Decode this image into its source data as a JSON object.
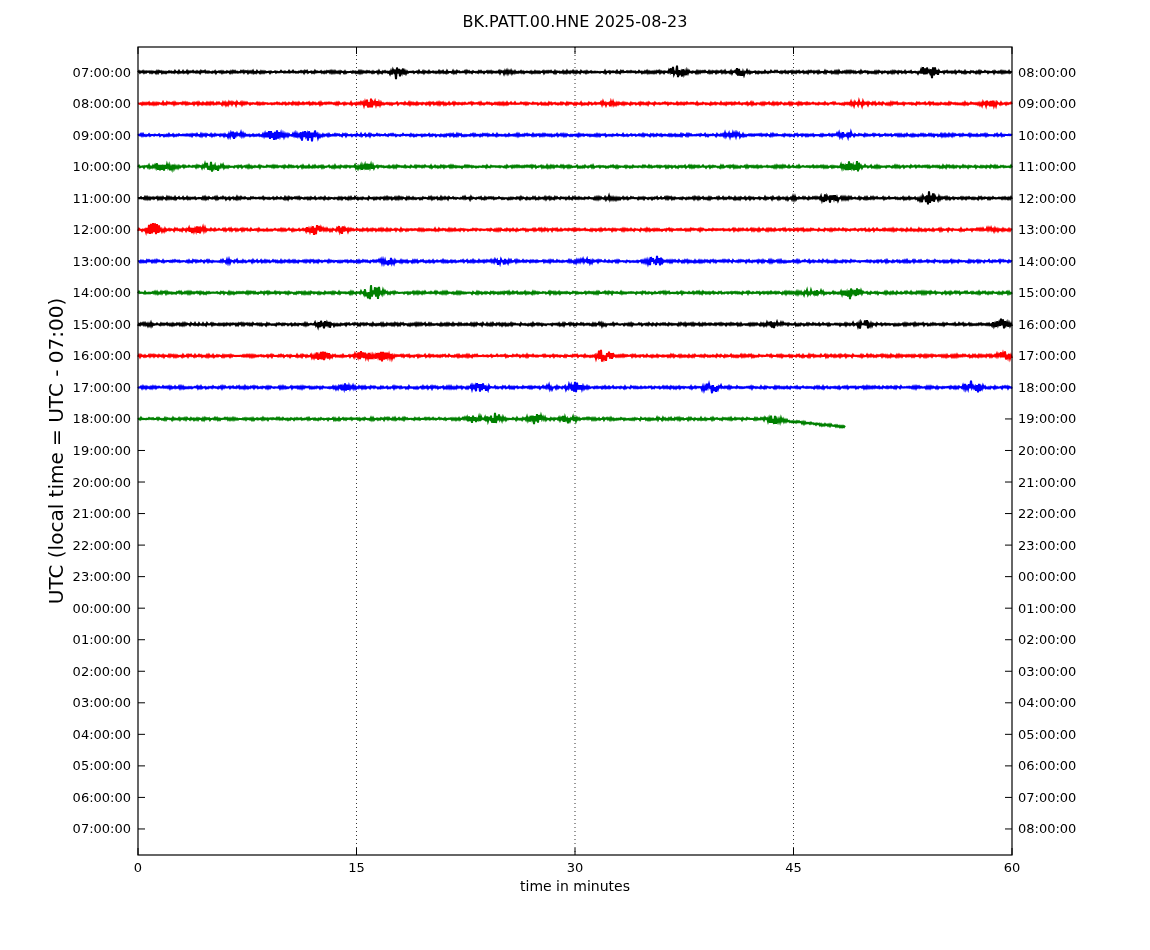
{
  "title": "BK.PATT.00.HNE 2025-08-23",
  "ylabel": "UTC (local time = UTC - 07:00)",
  "xlabel": "time in minutes",
  "xticks": [
    "0",
    "15",
    "30",
    "45",
    "60"
  ],
  "left_ticks": [
    "07:00:00",
    "08:00:00",
    "09:00:00",
    "10:00:00",
    "11:00:00",
    "12:00:00",
    "13:00:00",
    "14:00:00",
    "15:00:00",
    "16:00:00",
    "17:00:00",
    "18:00:00",
    "19:00:00",
    "20:00:00",
    "21:00:00",
    "22:00:00",
    "23:00:00",
    "00:00:00",
    "01:00:00",
    "02:00:00",
    "03:00:00",
    "04:00:00",
    "05:00:00",
    "06:00:00",
    "07:00:00"
  ],
  "right_ticks": [
    "08:00:00",
    "09:00:00",
    "10:00:00",
    "11:00:00",
    "12:00:00",
    "13:00:00",
    "14:00:00",
    "15:00:00",
    "16:00:00",
    "17:00:00",
    "18:00:00",
    "19:00:00",
    "20:00:00",
    "21:00:00",
    "22:00:00",
    "23:00:00",
    "00:00:00",
    "01:00:00",
    "02:00:00",
    "03:00:00",
    "04:00:00",
    "05:00:00",
    "06:00:00",
    "07:00:00",
    "08:00:00"
  ],
  "traces": [
    {
      "color": "#000000",
      "level": 1
    },
    {
      "color": "#ff0000",
      "level": 1
    },
    {
      "color": "#0000ff",
      "level": 1
    },
    {
      "color": "#008000",
      "level": 1
    },
    {
      "color": "#000000",
      "level": 1
    },
    {
      "color": "#ff0000",
      "level": 1
    },
    {
      "color": "#0000ff",
      "level": 1
    },
    {
      "color": "#008000",
      "level": 1
    },
    {
      "color": "#000000",
      "level": 1
    },
    {
      "color": "#ff0000",
      "level": 1
    },
    {
      "color": "#0000ff",
      "level": 1
    },
    {
      "color": "#008000",
      "level": 0.81
    }
  ]
}
